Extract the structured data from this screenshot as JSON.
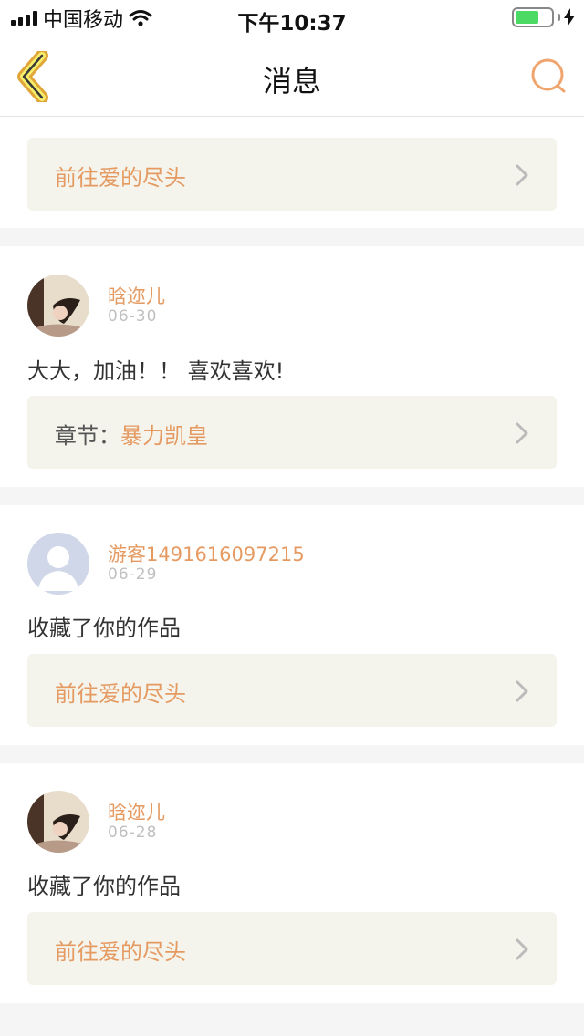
{
  "status_bar": {
    "carrier": "中国移动",
    "time": "下午10:37",
    "battery_percent": 65
  },
  "nav": {
    "title": "消息",
    "back_icon": "chevron-left-icon",
    "search_icon": "search-icon"
  },
  "colors": {
    "accent": "#e59a62",
    "back_arrow_fill": "#f7ee6a",
    "link_box_bg": "#f4f4ec"
  },
  "messages": [
    {
      "link": {
        "text": "前往爱的尽头"
      }
    },
    {
      "name": "晗迩儿",
      "date": "06-30",
      "text": "大大，加油！！ 喜欢喜欢!",
      "link": {
        "prefix": "章节：",
        "text": "暴力凯皇"
      }
    },
    {
      "name": "游客1491616097215",
      "date": "06-29",
      "text": "收藏了你的作品",
      "link": {
        "text": "前往爱的尽头"
      }
    },
    {
      "name": "晗迩儿",
      "date": "06-28",
      "text": "收藏了你的作品",
      "link": {
        "text": "前往爱的尽头"
      }
    }
  ]
}
